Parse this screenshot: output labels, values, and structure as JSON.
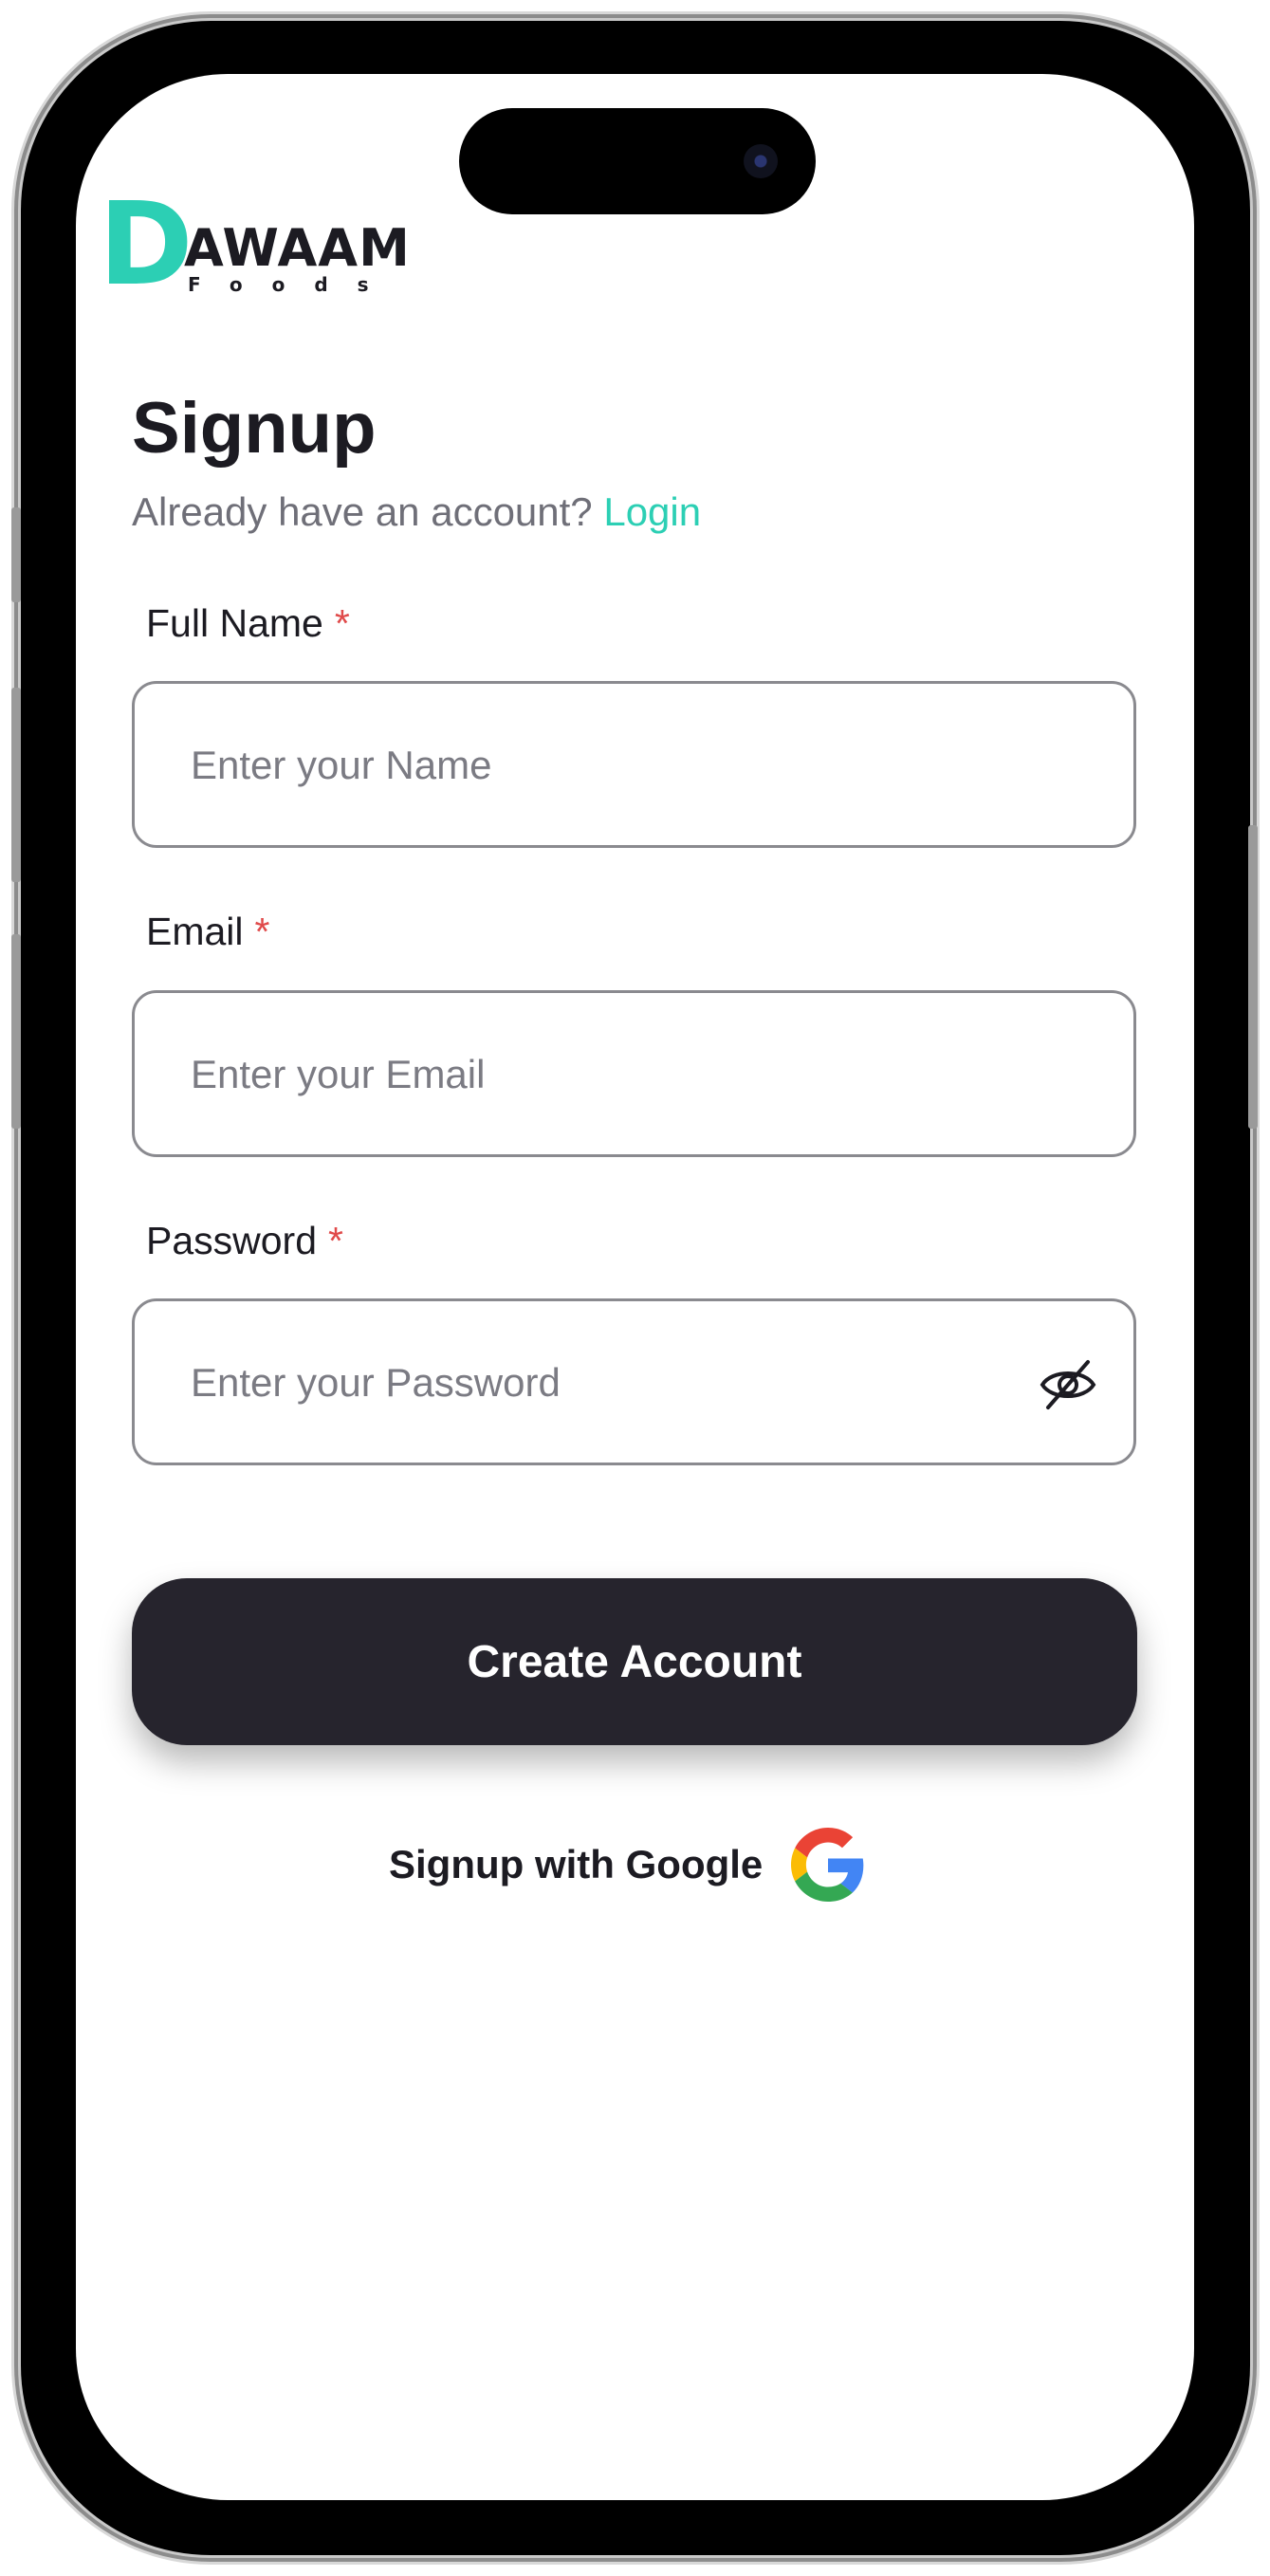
{
  "brand": {
    "logo_letter": "D",
    "logo_word": "AWAAM",
    "logo_sub": "Foods",
    "accent": "#2ccfb4",
    "dark": "#26242d"
  },
  "signup": {
    "title": "Signup",
    "already_text": "Already have an account?",
    "login_link": "Login"
  },
  "form": {
    "full_name": {
      "label": "Full Name",
      "required": "*",
      "placeholder": "Enter your Name",
      "value": ""
    },
    "email": {
      "label": "Email",
      "required": "*",
      "placeholder": "Enter your Email",
      "value": ""
    },
    "password": {
      "label": "Password",
      "required": "*",
      "placeholder": "Enter your Password",
      "value": "",
      "toggle_icon": "eye-off-icon"
    }
  },
  "actions": {
    "create_account": "Create Account",
    "google_signup": "Signup with Google",
    "google_icon": "google-icon"
  }
}
